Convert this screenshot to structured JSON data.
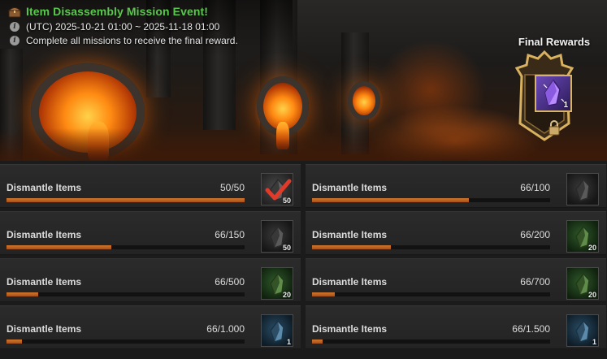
{
  "event": {
    "title": "Item Disassembly Mission Event!",
    "period": "(UTC) 2025-10-21 01:00 ~ 2025-11-18 01:00",
    "description": "Complete all missions to receive the final reward."
  },
  "final_rewards": {
    "label": "Final Rewards",
    "count": "1",
    "icon": "purple-crystal-icon",
    "locked": true
  },
  "colors": {
    "title_green": "#58c84a",
    "progress_orange": "#c86a26",
    "check_red": "#e03a2a"
  },
  "missions": [
    {
      "label": "Dismantle Items",
      "progress": "50/50",
      "fraction": 1.0,
      "reward_qty": "50",
      "reward_tint": "done",
      "completed": true
    },
    {
      "label": "Dismantle Items",
      "progress": "66/100",
      "fraction": 0.66,
      "reward_qty": "",
      "reward_tint": "dark",
      "completed": false
    },
    {
      "label": "Dismantle Items",
      "progress": "66/150",
      "fraction": 0.44,
      "reward_qty": "50",
      "reward_tint": "dark",
      "completed": false
    },
    {
      "label": "Dismantle Items",
      "progress": "66/200",
      "fraction": 0.33,
      "reward_qty": "20",
      "reward_tint": "green",
      "completed": false
    },
    {
      "label": "Dismantle Items",
      "progress": "66/500",
      "fraction": 0.132,
      "reward_qty": "20",
      "reward_tint": "green",
      "completed": false
    },
    {
      "label": "Dismantle Items",
      "progress": "66/700",
      "fraction": 0.094,
      "reward_qty": "20",
      "reward_tint": "green",
      "completed": false
    },
    {
      "label": "Dismantle Items",
      "progress": "66/1.000",
      "fraction": 0.066,
      "reward_qty": "1",
      "reward_tint": "blue",
      "completed": false
    },
    {
      "label": "Dismantle Items",
      "progress": "66/1.500",
      "fraction": 0.044,
      "reward_qty": "1",
      "reward_tint": "blue",
      "completed": false
    }
  ]
}
